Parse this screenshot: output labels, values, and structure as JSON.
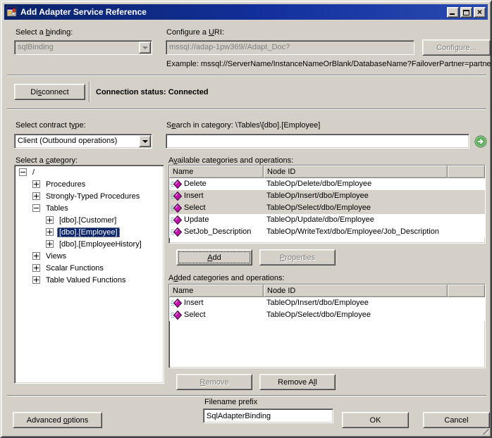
{
  "window": {
    "title": "Add Adapter Service Reference"
  },
  "binding": {
    "label": {
      "pre": "Select a ",
      "key": "b",
      "post": "inding:"
    },
    "value": "sqlBinding"
  },
  "uri": {
    "label": {
      "pre": "Configure a ",
      "key": "U",
      "post": "RI:"
    },
    "value": "mssql://adap-1pw369//Adapt_Doc?",
    "configure_label": "Configure...",
    "example": "Example: mssql://ServerName/InstanceNameOrBlank/DatabaseName?FailoverPartner=partner"
  },
  "connection": {
    "disconnect": {
      "pre": "Di",
      "key": "s",
      "post": "connect"
    },
    "status_label": "Connection status:",
    "status_value": "Connected"
  },
  "contract": {
    "label": {
      "pre": "Select contract t",
      "key": "y",
      "post": "pe:"
    },
    "value": "Client (Outbound operations)"
  },
  "search": {
    "label": {
      "pre": "S",
      "key": "e",
      "post": "arch in category: \\Tables\\[dbo].[Employee]"
    },
    "value": "",
    "go_icon": "green-go-arrow"
  },
  "category": {
    "label": {
      "pre": "Select a ",
      "key": "c",
      "post": "ategory:"
    },
    "tree": [
      {
        "label": "/",
        "level": 0,
        "expander": "minus",
        "selected": false
      },
      {
        "label": "Procedures",
        "level": 1,
        "expander": "plus",
        "selected": false
      },
      {
        "label": "Strongly-Typed Procedures",
        "level": 1,
        "expander": "plus",
        "selected": false
      },
      {
        "label": "Tables",
        "level": 1,
        "expander": "minus",
        "selected": false
      },
      {
        "label": "[dbo].[Customer]",
        "level": 2,
        "expander": "plus",
        "selected": false
      },
      {
        "label": "[dbo].[Employee]",
        "level": 2,
        "expander": "plus",
        "selected": true
      },
      {
        "label": "[dbo].[EmployeeHistory]",
        "level": 2,
        "expander": "plus",
        "selected": false
      },
      {
        "label": "Views",
        "level": 1,
        "expander": "plus",
        "selected": false
      },
      {
        "label": "Scalar Functions",
        "level": 1,
        "expander": "plus",
        "selected": false
      },
      {
        "label": "Table Valued Functions",
        "level": 1,
        "expander": "plus",
        "selected": false
      }
    ]
  },
  "available": {
    "label": {
      "pre": "A",
      "key": "v",
      "post": "ailable categories and operations:"
    },
    "columns": [
      "Name",
      "Node ID"
    ],
    "rows": [
      {
        "name": "Delete",
        "node_id": "TableOp/Delete/dbo/Employee",
        "selected": false
      },
      {
        "name": "Insert",
        "node_id": "TableOp/Insert/dbo/Employee",
        "selected": true
      },
      {
        "name": "Select",
        "node_id": "TableOp/Select/dbo/Employee",
        "selected": true
      },
      {
        "name": "Update",
        "node_id": "TableOp/Update/dbo/Employee",
        "selected": false
      },
      {
        "name": "SetJob_Description",
        "node_id": "TableOp/WriteText/dbo/Employee/Job_Description",
        "selected": false
      }
    ],
    "add": {
      "pre": "",
      "key": "A",
      "post": "dd"
    },
    "properties": {
      "pre": "",
      "key": "P",
      "post": "roperties"
    }
  },
  "added": {
    "label": {
      "pre": "A",
      "key": "d",
      "post": "ded categories and operations:"
    },
    "columns": [
      "Name",
      "Node ID"
    ],
    "rows": [
      {
        "name": "Insert",
        "node_id": "TableOp/Insert/dbo/Employee",
        "selected": false
      },
      {
        "name": "Select",
        "node_id": "TableOp/Select/dbo/Employee",
        "selected": false
      }
    ],
    "remove": {
      "pre": "",
      "key": "R",
      "post": "emove"
    },
    "remove_all": {
      "pre": "Remove A",
      "key": "l",
      "post": "l"
    }
  },
  "footer": {
    "advanced": {
      "pre": "Advanced ",
      "key": "o",
      "post": "ptions"
    },
    "filename_label": "Filename prefix",
    "filename_value": "SqlAdapterBinding",
    "ok_label": "OK",
    "cancel_label": "Cancel"
  },
  "colors": {
    "titlebar": "#0a246a",
    "dialog_face": "#d4d0c8",
    "selection": "#0a246a",
    "row_highlight": "#d6d2ca",
    "operation_icon": "#c014ad",
    "go_button_green": "#4b9e4b"
  }
}
